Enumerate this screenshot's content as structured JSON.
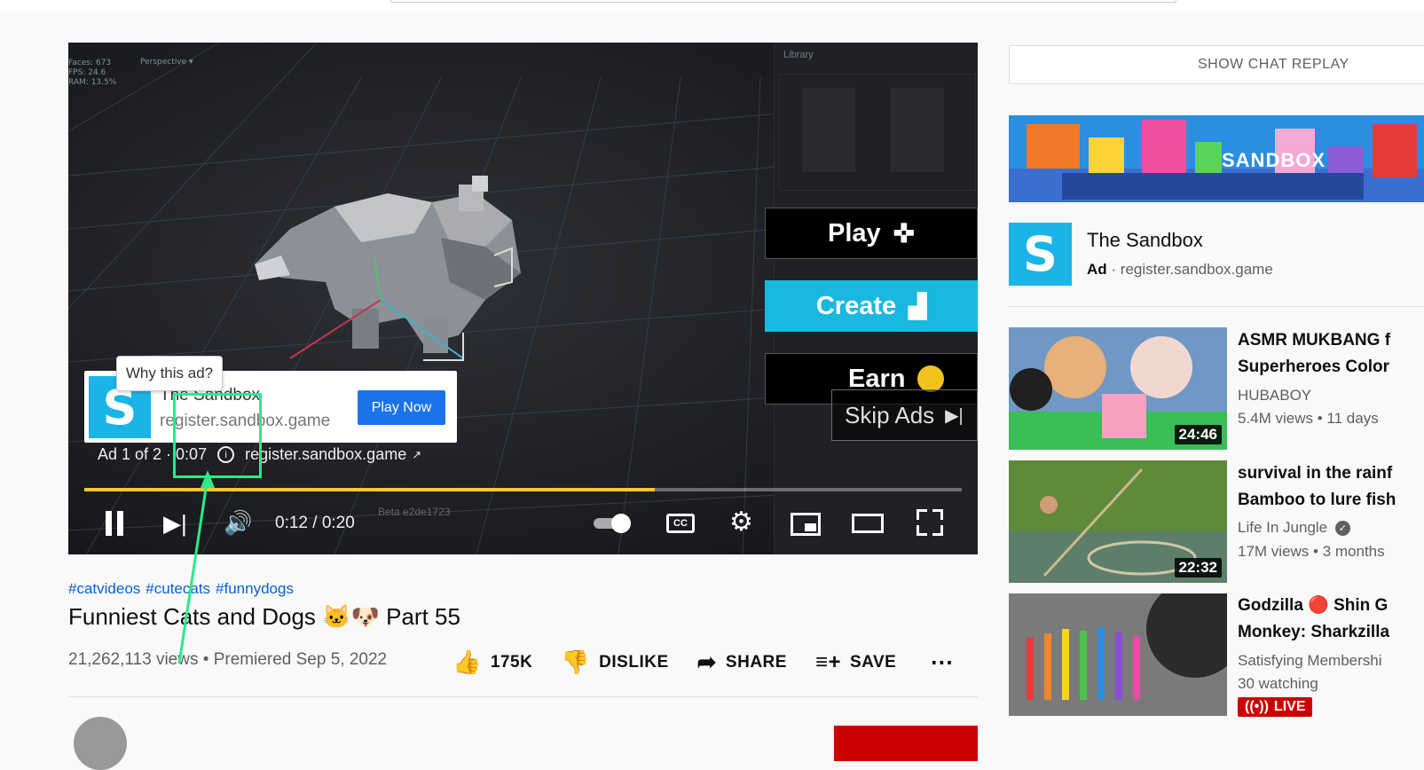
{
  "player": {
    "hud": {
      "faces": "Faces: 673",
      "fps": "FPS: 24.6",
      "ram": "RAM: 13.5%",
      "view": "Perspective",
      "library": "Library"
    },
    "menu": {
      "play": "Play",
      "create": "Create",
      "earn": "Earn"
    },
    "skip_label": "Skip Ads",
    "ad_card": {
      "title": "The Sandbox",
      "url": "register.sandbox.game",
      "cta": "Play Now"
    },
    "tooltip": "Why this ad?",
    "ad_info": {
      "counter": "Ad 1 of 2 · 0:07",
      "url": "register.sandbox.game"
    },
    "progress": 0.65,
    "time": "0:12 / 0:20",
    "beta": "Beta e2de1723"
  },
  "video": {
    "hashtags": [
      "#catvideos",
      "#cutecats",
      "#funnydogs"
    ],
    "title": "Funniest Cats and Dogs 🐱🐶 Part 55",
    "views": "21,262,113 views",
    "premiered": "Premiered Sep 5, 2022",
    "actions": {
      "like": "175K",
      "dislike": "DISLIKE",
      "share": "SHARE",
      "save": "SAVE"
    }
  },
  "sidebar": {
    "chat_replay": "SHOW CHAT REPLAY",
    "banner_text": "SANDBOX",
    "sponsor": {
      "name": "The Sandbox",
      "ad_label": "Ad",
      "url": "register.sandbox.game"
    },
    "related": [
      {
        "title_1": "ASMR MUKBANG f",
        "title_2": "Superheroes Color",
        "channel": "HUBABOY",
        "meta": "5.4M views • 11 days",
        "duration": "24:46"
      },
      {
        "title_1": "survival in the rainf",
        "title_2": "Bamboo to lure fish",
        "channel": "Life In Jungle",
        "meta": "17M views • 3 months",
        "duration": "22:32"
      },
      {
        "title_1": "Godzilla 🔴 Shin G",
        "title_2": "Monkey: Sharkzilla",
        "channel": "Satisfying Membershi",
        "meta": "30 watching",
        "live": "LIVE"
      }
    ]
  },
  "colors": {
    "accent_blue": "#1ab5e6",
    "progress_yellow": "#fcc62d",
    "live_red": "#cc0000",
    "annotation_green": "#2ee88a",
    "link_blue": "#065fd4"
  }
}
